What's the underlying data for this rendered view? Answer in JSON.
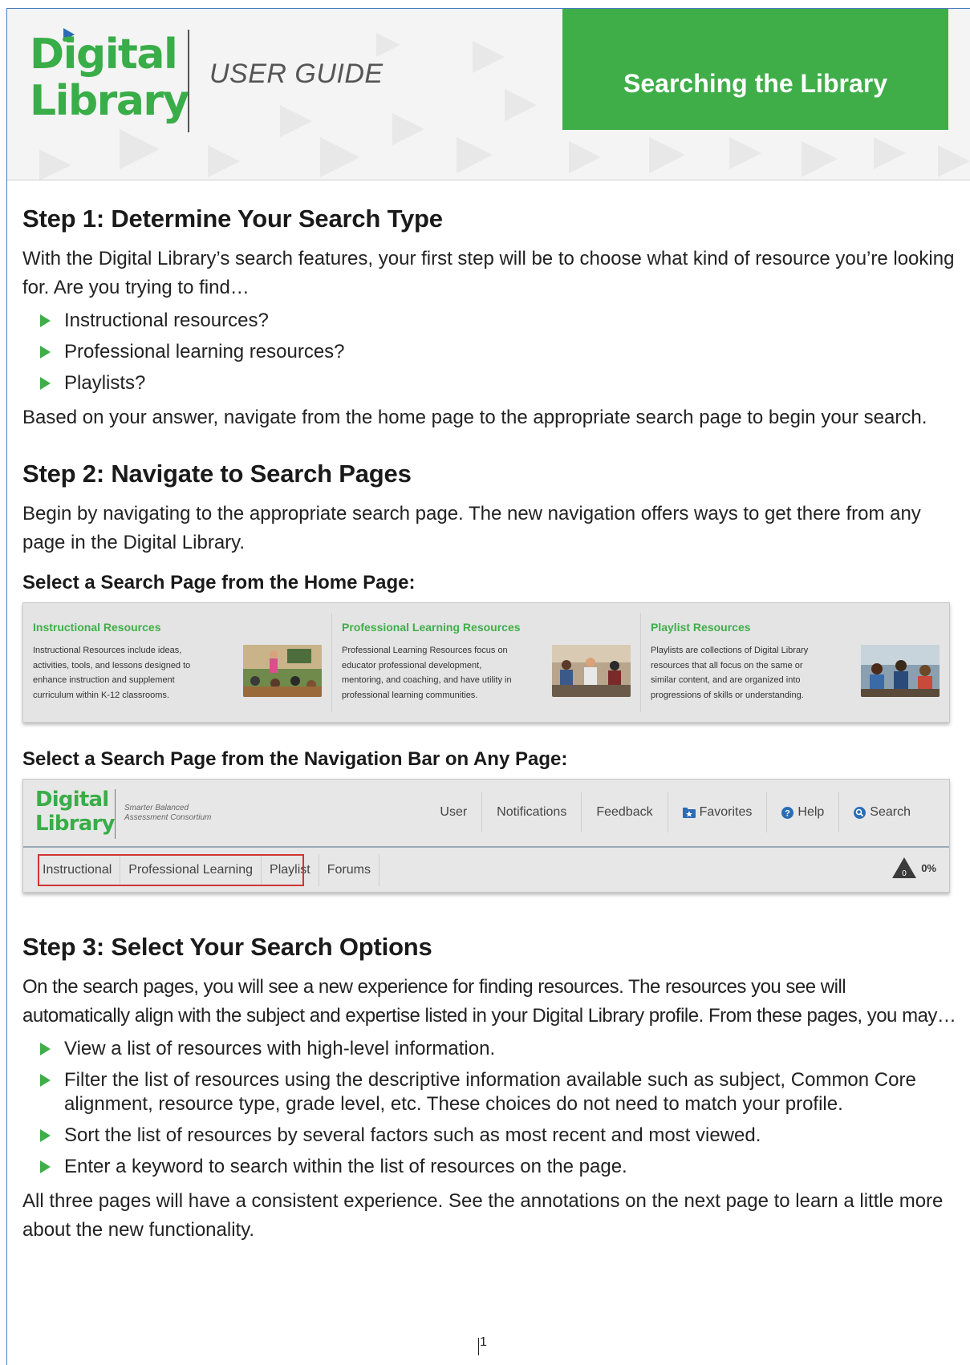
{
  "header": {
    "logo_line1": "Digital",
    "logo_line2": "Library",
    "guide_label": "USER GUIDE",
    "title": "Searching the Library"
  },
  "step1": {
    "heading": "Step 1: Determine Your Search Type",
    "intro": "With the Digital Library’s search features, your first step will be to choose what kind of resource you’re looking for. Are you trying to find…",
    "bullets": [
      "Instructional resources?",
      "Professional learning resources?",
      "Playlists?"
    ],
    "outro": "Based on your answer, navigate from the home page to the appropriate search page to begin your search."
  },
  "step2": {
    "heading": "Step 2: Navigate to Search Pages",
    "intro": "Begin by navigating to the appropriate search page. The new navigation offers ways to get there from any page in the Digital Library.",
    "home_heading": "Select a Search Page from the Home Page:",
    "home_cards": [
      {
        "title": "Instructional Resources",
        "desc": "Instructional Resources include ideas, activities, tools, and lessons designed to enhance instruction and supplement curriculum within K-12 classrooms."
      },
      {
        "title": "Professional Learning Resources",
        "desc": "Professional Learning Resources focus on educator professional development, mentoring, and coaching, and have utility in professional learning communities."
      },
      {
        "title": "Playlist Resources",
        "desc": "Playlists are collections of Digital Library resources that all focus on the same or similar content, and are organized into progressions of skills or understanding."
      }
    ],
    "nav_heading": "Select a Search Page from the Navigation Bar on Any Page:",
    "nav": {
      "logo_line1": "Digital",
      "logo_line2": "Library",
      "sbac_line1": "Smarter Balanced",
      "sbac_line2": "Assessment Consortium",
      "links": [
        "User",
        "Notifications",
        "Feedback",
        "Favorites",
        "Help",
        "Search"
      ],
      "tabs": [
        "Instructional",
        "Professional Learning",
        "Playlist",
        "Forums"
      ],
      "progress_count": "0",
      "progress_pct": "0%"
    }
  },
  "step3": {
    "heading": "Step 3: Select Your Search Options",
    "intro": "On the search pages, you will see a new experience for finding resources. The resources you see will automatically align with the subject and expertise listed in your Digital Library profile. From these pages, you may…",
    "bullets": [
      "View a list of resources with high-level information.",
      "Filter the list of resources using the descriptive information available such as subject, Common Core alignment, resource type, grade level, etc. These choices do not need to match your profile.",
      "Sort the list of resources by several factors such as most recent and most viewed.",
      "Enter a keyword to search within the list of resources on the page."
    ],
    "outro": "All three pages will have a consistent experience. See the annotations on the next page to learn a little more about the new functionality."
  },
  "footer": {
    "page_number": "1"
  },
  "colors": {
    "brand_green": "#3fae49",
    "highlight_red": "#d03535"
  }
}
